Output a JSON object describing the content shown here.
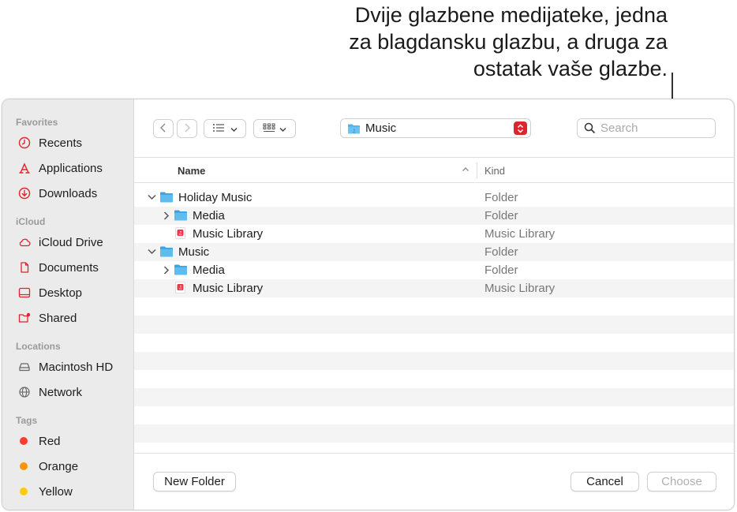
{
  "callout": {
    "line1": "Dvije glazbene medijateke, jedna",
    "line2": "za blagdansku glazbu, a druga za",
    "line3": "ostatak vaše glazbe."
  },
  "sidebar": {
    "sections": [
      {
        "title": "Favorites",
        "items": [
          {
            "label": "Recents",
            "icon": "clock-icon"
          },
          {
            "label": "Applications",
            "icon": "applications-icon"
          },
          {
            "label": "Downloads",
            "icon": "download-icon"
          }
        ]
      },
      {
        "title": "iCloud",
        "items": [
          {
            "label": "iCloud Drive",
            "icon": "cloud-icon"
          },
          {
            "label": "Documents",
            "icon": "document-icon"
          },
          {
            "label": "Desktop",
            "icon": "desktop-icon"
          },
          {
            "label": "Shared",
            "icon": "shared-folder-icon"
          }
        ]
      },
      {
        "title": "Locations",
        "items": [
          {
            "label": "Macintosh HD",
            "icon": "disk-icon"
          },
          {
            "label": "Network",
            "icon": "globe-icon"
          }
        ]
      },
      {
        "title": "Tags",
        "items": [
          {
            "label": "Red",
            "icon": "tag-dot-icon",
            "color": "#ff3b30"
          },
          {
            "label": "Orange",
            "icon": "tag-dot-icon",
            "color": "#ff9500"
          },
          {
            "label": "Yellow",
            "icon": "tag-dot-icon",
            "color": "#ffcc00"
          }
        ]
      }
    ]
  },
  "toolbar": {
    "location": "Music",
    "search_placeholder": "Search"
  },
  "columns": {
    "name": "Name",
    "kind": "Kind"
  },
  "rows": [
    {
      "name": "Holiday Music",
      "kind": "Folder",
      "level": 0,
      "disclosure": "expanded",
      "icon": "folder-icon"
    },
    {
      "name": "Media",
      "kind": "Folder",
      "level": 1,
      "disclosure": "collapsed",
      "icon": "folder-icon"
    },
    {
      "name": "Music Library",
      "kind": "Music Library",
      "level": 1,
      "disclosure": "none",
      "icon": "music-library-icon"
    },
    {
      "name": "Music",
      "kind": "Folder",
      "level": 0,
      "disclosure": "expanded",
      "icon": "folder-icon"
    },
    {
      "name": "Media",
      "kind": "Folder",
      "level": 1,
      "disclosure": "collapsed",
      "icon": "folder-icon"
    },
    {
      "name": "Music Library",
      "kind": "Music Library",
      "level": 1,
      "disclosure": "none",
      "icon": "music-library-icon"
    }
  ],
  "footer": {
    "new_folder": "New Folder",
    "cancel": "Cancel",
    "choose": "Choose"
  },
  "colors": {
    "folder": "#4fb3ea",
    "music_icon": "#f0364a",
    "accent": "#e0242b"
  }
}
